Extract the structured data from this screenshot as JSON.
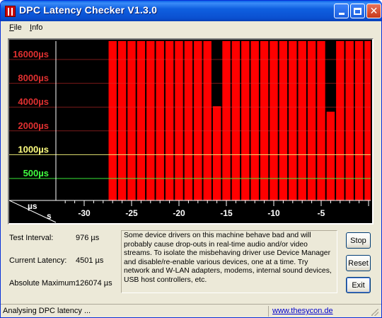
{
  "window": {
    "title": "DPC Latency Checker V1.3.0"
  },
  "menu": {
    "file": {
      "accel": "F",
      "rest": "ile"
    },
    "info": {
      "accel": "I",
      "rest": "nfo"
    }
  },
  "chart_data": {
    "type": "bar",
    "y_scale": "log",
    "y_unit": "µs",
    "x_unit": "s",
    "axis_corner_top": "µs",
    "axis_corner_bottom": "s",
    "y_ticks": [
      {
        "value": 16000,
        "label": "16000µs",
        "color": "#e03030"
      },
      {
        "value": 8000,
        "label": "8000µs",
        "color": "#e03030"
      },
      {
        "value": 4000,
        "label": "4000µs",
        "color": "#e03030"
      },
      {
        "value": 2000,
        "label": "2000µs",
        "color": "#e03030"
      },
      {
        "value": 1000,
        "label": "1000µs",
        "color": "#ffff80"
      },
      {
        "value": 500,
        "label": "500µs",
        "color": "#40ff40"
      }
    ],
    "x_ticks": [
      {
        "value": -30,
        "label": "-30"
      },
      {
        "value": -25,
        "label": "-25"
      },
      {
        "value": -20,
        "label": "-20"
      },
      {
        "value": -15,
        "label": "-15"
      },
      {
        "value": -10,
        "label": "-10"
      },
      {
        "value": -5,
        "label": "-5"
      }
    ],
    "x_range": [
      -33,
      0
    ],
    "bar_color": "#ff0000",
    "bars": [
      {
        "t": -27,
        "value": 32000
      },
      {
        "t": -26,
        "value": 32000
      },
      {
        "t": -25,
        "value": 32000
      },
      {
        "t": -24,
        "value": 32000
      },
      {
        "t": -23,
        "value": 32000
      },
      {
        "t": -22,
        "value": 32000
      },
      {
        "t": -21,
        "value": 32000
      },
      {
        "t": -20,
        "value": 32000
      },
      {
        "t": -19,
        "value": 32000
      },
      {
        "t": -18,
        "value": 32000
      },
      {
        "t": -17,
        "value": 32000
      },
      {
        "t": -16,
        "value": 4100
      },
      {
        "t": -15,
        "value": 32000
      },
      {
        "t": -14,
        "value": 32000
      },
      {
        "t": -13,
        "value": 32000
      },
      {
        "t": -12,
        "value": 32000
      },
      {
        "t": -11,
        "value": 32000
      },
      {
        "t": -10,
        "value": 32000
      },
      {
        "t": -9,
        "value": 32000
      },
      {
        "t": -8,
        "value": 32000
      },
      {
        "t": -7,
        "value": 32000
      },
      {
        "t": -6,
        "value": 32000
      },
      {
        "t": -5,
        "value": 32000
      },
      {
        "t": -4,
        "value": 3500
      },
      {
        "t": -3,
        "value": 32000
      },
      {
        "t": -2,
        "value": 32000
      },
      {
        "t": -1,
        "value": 32000
      },
      {
        "t": 0,
        "value": 32000
      }
    ]
  },
  "stats": {
    "test_interval_label": "Test Interval:",
    "test_interval_value": "976 µs",
    "current_latency_label": "Current Latency:",
    "current_latency_value": "4501 µs",
    "absolute_maximum_label": "Absolute Maximum:",
    "absolute_maximum_value": "126074 µs"
  },
  "description": "Some device drivers on this machine behave bad and will probably cause drop-outs in real-time audio and/or video streams. To isolate the misbehaving driver use Device Manager and disable/re-enable various devices, one at a time. Try network and W-LAN adapters, modems, internal sound devices, USB host controllers, etc.",
  "buttons": {
    "stop": "Stop",
    "reset": "Reset",
    "exit": "Exit"
  },
  "status": {
    "message": "Analysing DPC latency ...",
    "link": "www.thesycon.de"
  }
}
